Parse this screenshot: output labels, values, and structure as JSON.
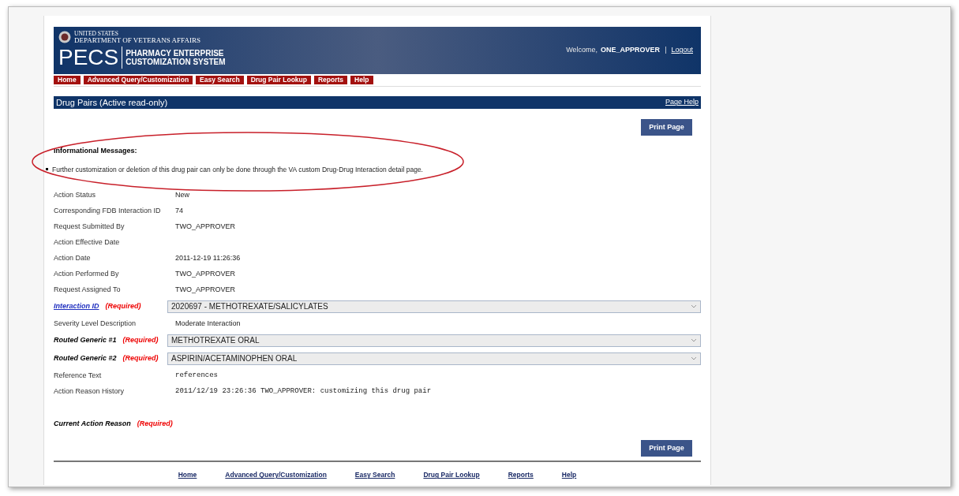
{
  "header": {
    "agency_line1": "UNITED STATES",
    "agency_line2": "DEPARTMENT OF VETERANS AFFAIRS",
    "logo": "PECS",
    "system_name_line1": "PHARMACY ENTERPRISE",
    "system_name_line2": "CUSTOMIZATION SYSTEM",
    "welcome": "Welcome,",
    "user": "ONE_APPROVER",
    "separator": "|",
    "logout": "Logout"
  },
  "nav": [
    "Home",
    "Advanced Query/Customization",
    "Easy Search",
    "Drug Pair Lookup",
    "Reports",
    "Help"
  ],
  "title_bar": {
    "title": "Drug Pairs (Active read-only)",
    "help": "Page Help"
  },
  "print_button_top": "Print Page",
  "messages": {
    "heading": "Informational Messages:",
    "items": [
      "Further customization or deletion of this drug pair can only be done through the VA custom Drug-Drug Interaction detail page."
    ]
  },
  "fields": [
    {
      "label": {
        "kind": "plain",
        "text": "Action Status"
      },
      "value": {
        "kind": "text",
        "text": "New"
      }
    },
    {
      "label": {
        "kind": "plain",
        "text": "Corresponding FDB Interaction ID"
      },
      "value": {
        "kind": "text",
        "text": "74"
      }
    },
    {
      "label": {
        "kind": "plain",
        "text": "Request Submitted By"
      },
      "value": {
        "kind": "text",
        "text": "TWO_APPROVER"
      }
    },
    {
      "label": {
        "kind": "plain",
        "text": "Action Effective Date"
      }
    },
    {
      "label": {
        "kind": "plain",
        "text": "Action Date"
      },
      "value": {
        "kind": "text",
        "text": "2011-12-19 11:26:36"
      }
    },
    {
      "label": {
        "kind": "plain",
        "text": "Action Performed By"
      },
      "value": {
        "kind": "text",
        "text": "TWO_APPROVER"
      }
    },
    {
      "label": {
        "kind": "plain",
        "text": "Request Assigned To"
      },
      "value": {
        "kind": "text",
        "text": "TWO_APPROVER"
      }
    },
    {
      "label": {
        "kind": "link",
        "text": "Interaction ID",
        "required": "(Required)"
      },
      "value": {
        "kind": "select",
        "text": "2020697 - METHOTREXATE/SALICYLATES"
      }
    },
    {
      "label": {
        "kind": "plain",
        "text": "Severity Level Description"
      },
      "value": {
        "kind": "text",
        "text": "Moderate Interaction"
      }
    },
    {
      "label": {
        "kind": "bold",
        "text": "Routed Generic #1",
        "required": "(Required)"
      },
      "value": {
        "kind": "select",
        "text": "METHOTREXATE ORAL"
      }
    },
    {
      "label": {
        "kind": "bold",
        "text": "Routed Generic #2",
        "required": "(Required)"
      },
      "value": {
        "kind": "select",
        "text": "ASPIRIN/ACETAMINOPHEN ORAL"
      }
    },
    {
      "label": {
        "kind": "plain",
        "text": "Reference Text"
      },
      "value": {
        "kind": "mono",
        "text": "references"
      }
    },
    {
      "label": {
        "kind": "plain",
        "text": "Action Reason History"
      },
      "value": {
        "kind": "mono",
        "text": "2011/12/19 23:26:36 TWO_APPROVER: customizing this drug pair"
      }
    },
    {
      "label": {
        "kind": "bold",
        "text": "Current Action Reason",
        "required": "(Required)"
      }
    }
  ],
  "print_button_bottom": "Print Page",
  "footer_links": [
    "Home",
    "Advanced Query/Customization",
    "Easy Search",
    "Drug Pair Lookup",
    "Reports",
    "Help"
  ]
}
